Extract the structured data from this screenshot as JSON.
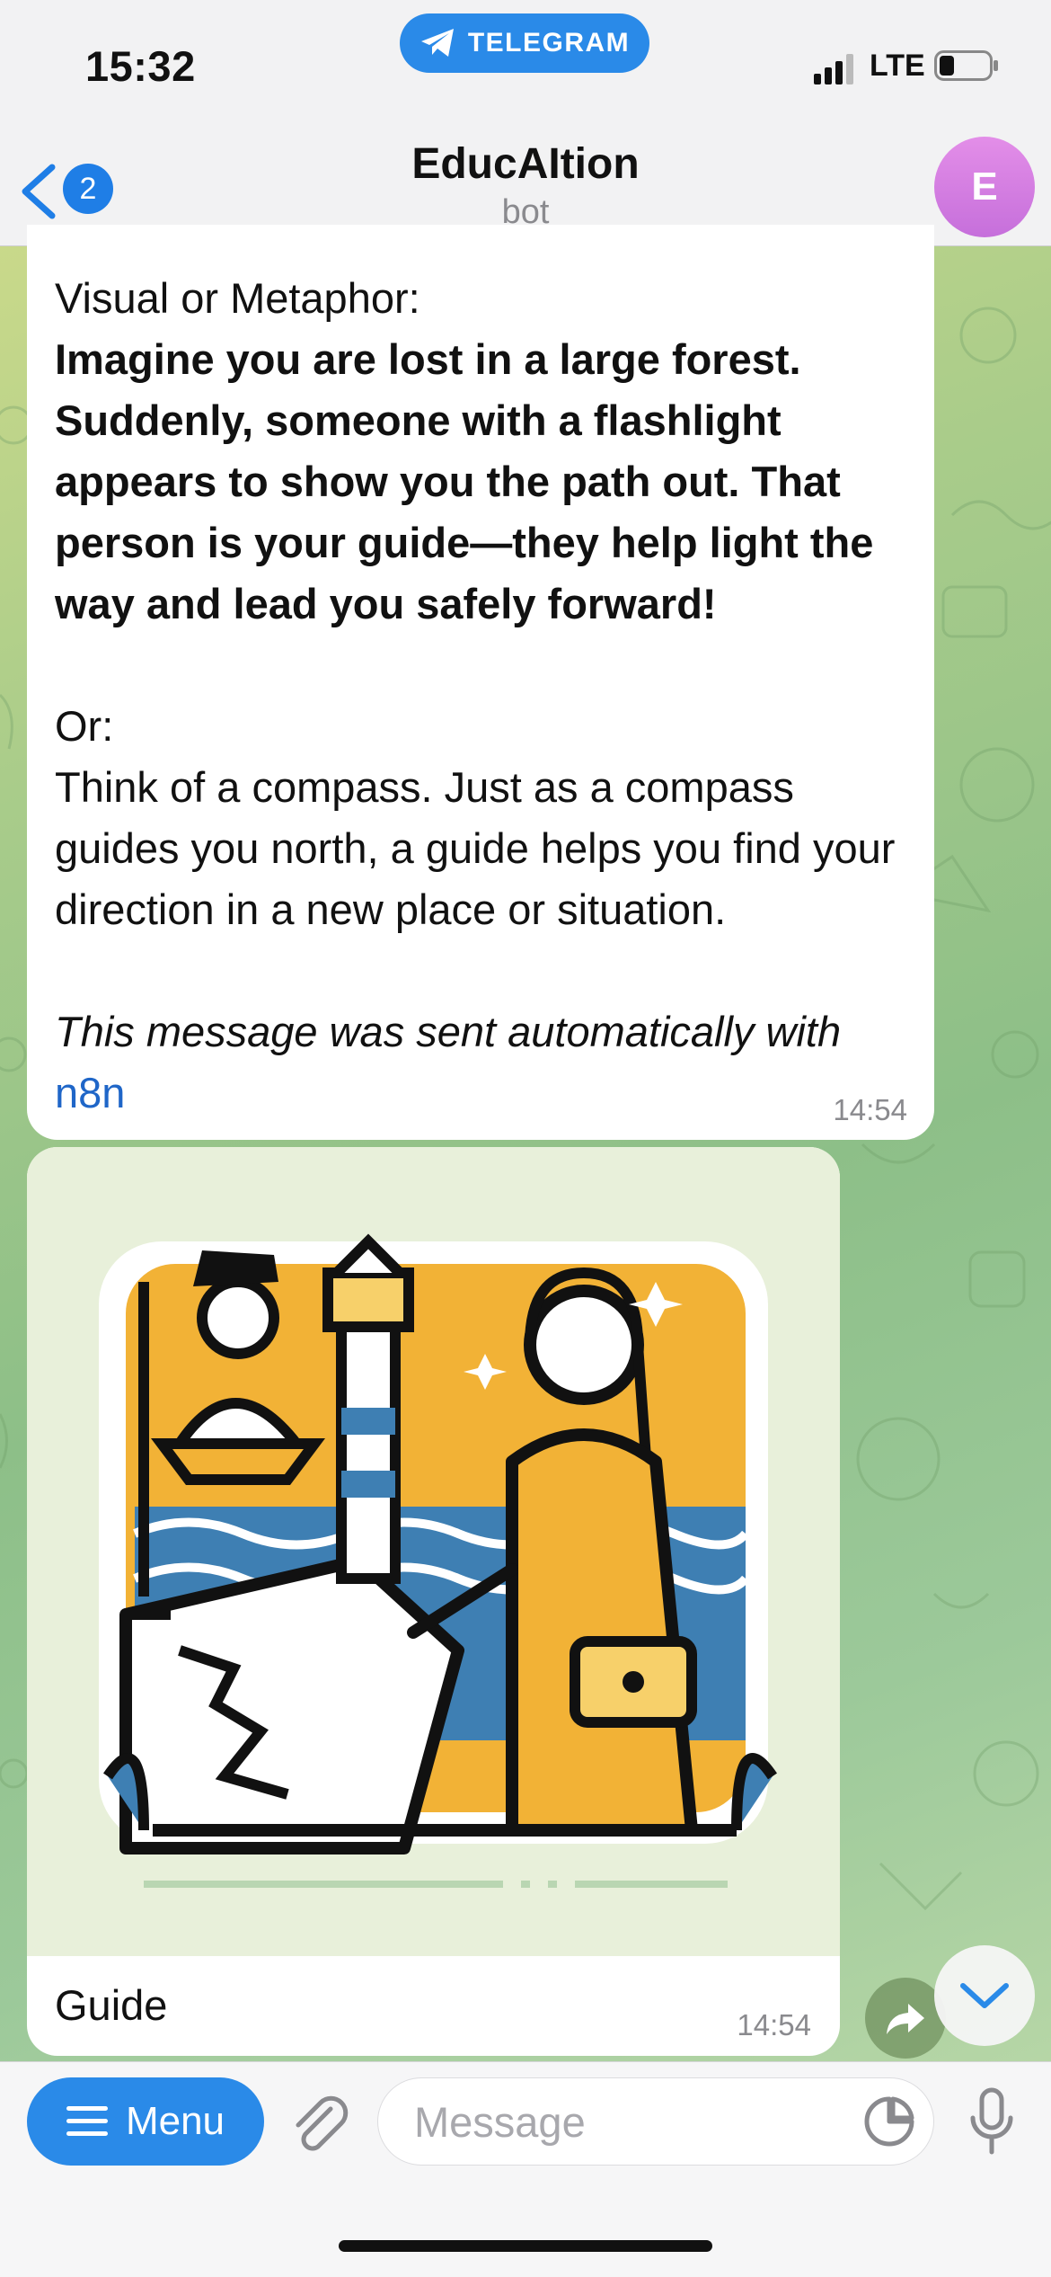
{
  "status_bar": {
    "time": "15:32",
    "app_pill": "TELEGRAM",
    "network": "LTE"
  },
  "nav": {
    "back_badge": "2",
    "title": "EducAItion",
    "subtitle": "bot",
    "avatar_letter": "E"
  },
  "messages": [
    {
      "heading": "Visual or Metaphor:",
      "bold_text": "Imagine you are lost in a large forest. Suddenly, someone with a flashlight appears to show you the path out. That person is your guide—they help light the way and lead you safely forward!",
      "or_label": "Or:",
      "body_text": "Think of a compass. Just as a compass guides you north, a guide helps you find your direction in a new place or situation.",
      "footer_text": "This message was sent automatically with ",
      "footer_link": "n8n",
      "time": "14:54"
    },
    {
      "caption": "Guide",
      "time": "14:54"
    }
  ],
  "input_bar": {
    "menu_label": "Menu",
    "placeholder": "Message"
  },
  "colors": {
    "accent": "#2a8ae8",
    "link": "#1f66c8",
    "avatar": "#d47ee0"
  }
}
